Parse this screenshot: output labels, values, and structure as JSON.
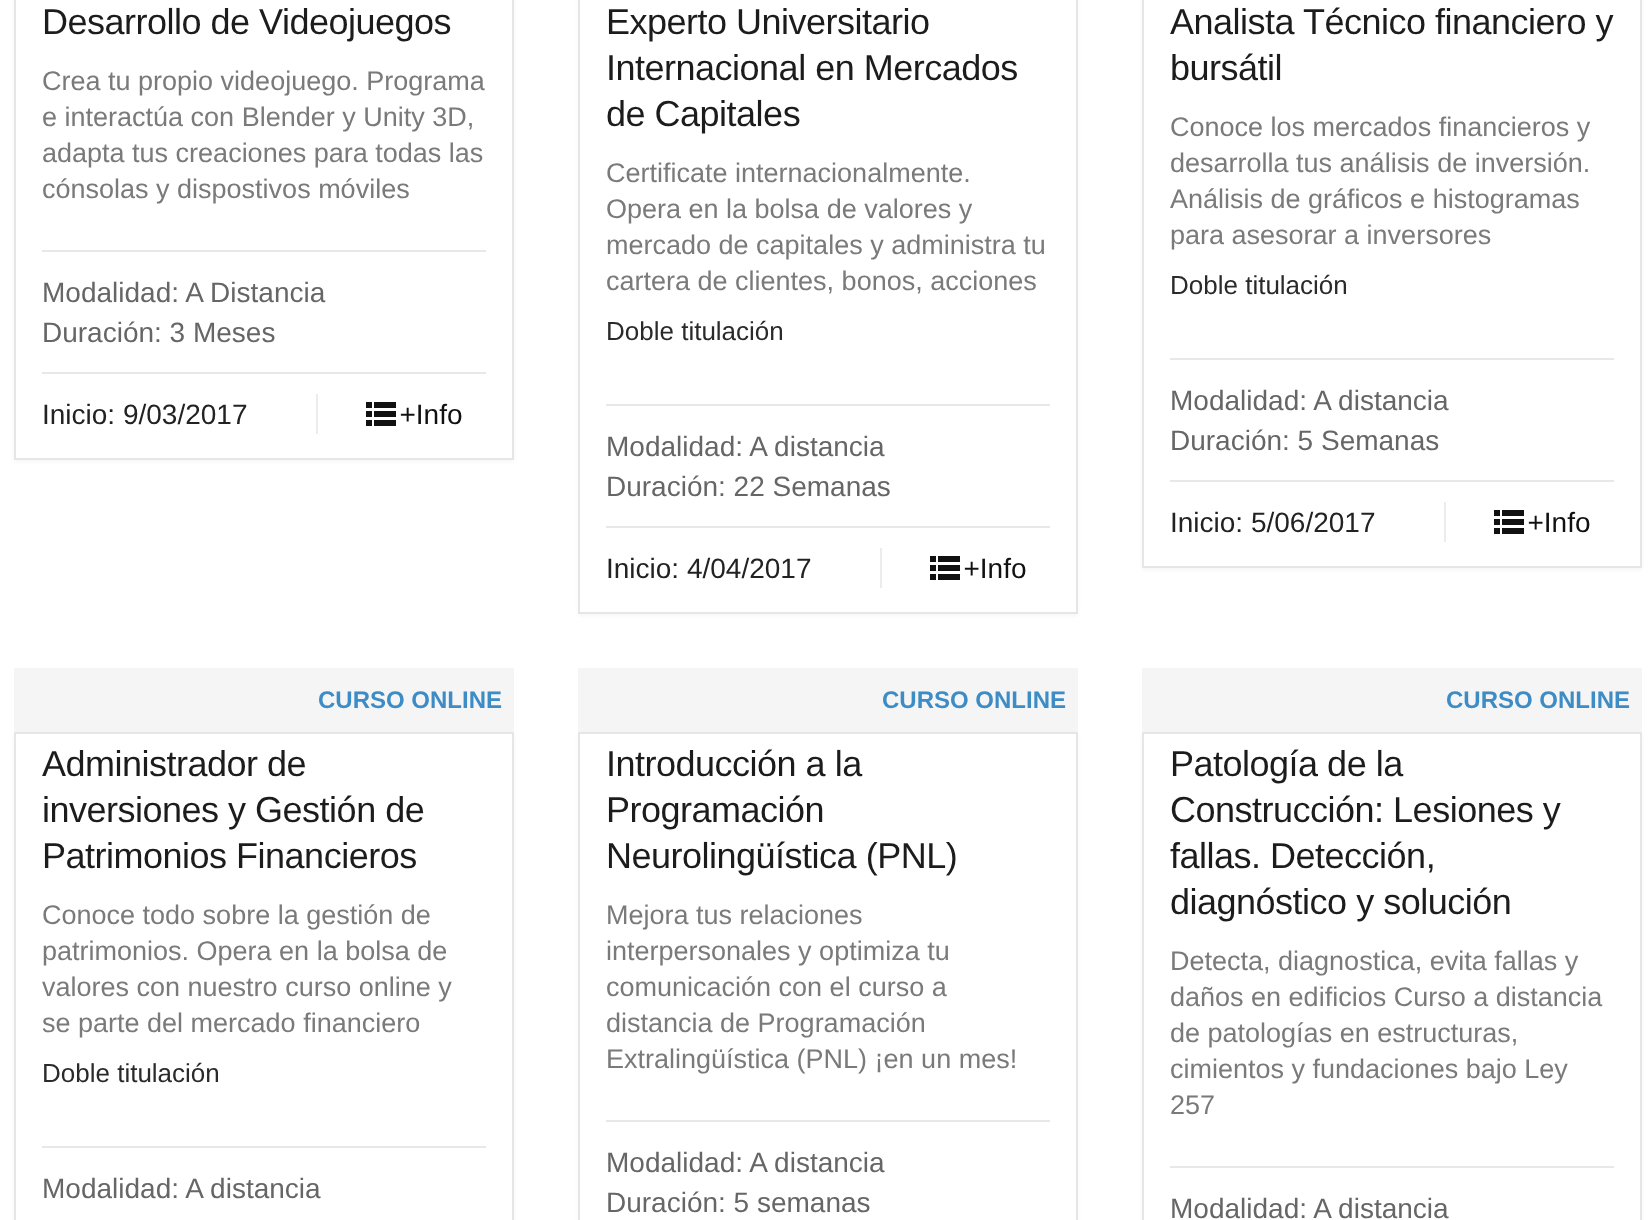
{
  "courses": [
    {
      "title": "Desarrollo de Videojuegos",
      "description": "Crea tu propio videojuego. Programa e interactúa con Blender y Unity 3D, adapta tus creaciones para todas las cónsolas y dispostivos móviles",
      "modality": "Modalidad: A Distancia",
      "duration": "Duración: 3 Meses",
      "start": "Inicio: 9/03/2017",
      "info_link": "+Info"
    },
    {
      "title": "Experto Universitario Internacional en Mercados de Capitales",
      "description": "Certificate internacionalmente. Opera en la bolsa de valores y mercado de capitales y administra tu cartera de clientes, bonos, acciones",
      "double_degree": "Doble titulación",
      "modality": "Modalidad: A distancia",
      "duration": "Duración: 22 Semanas",
      "start": "Inicio: 4/04/2017",
      "info_link": "+Info"
    },
    {
      "title": "Analista Técnico financiero y bursátil",
      "description": "Conoce los mercados financieros y desarrolla tus análisis de inversión. Análisis de gráficos e histogramas para asesorar a inversores",
      "double_degree": "Doble titulación",
      "modality": "Modalidad: A distancia",
      "duration": "Duración: 5 Semanas",
      "start": "Inicio: 5/06/2017",
      "info_link": "+Info"
    },
    {
      "badge": "CURSO ONLINE",
      "title": "Administrador de inversiones y Gestión de Patrimonios Financieros",
      "description": "Conoce todo sobre la gestión de patrimonios. Opera en la bolsa de valores con nuestro curso online y se parte del mercado financiero",
      "double_degree": "Doble titulación",
      "modality": "Modalidad: A distancia"
    },
    {
      "badge": "CURSO ONLINE",
      "title": "Introducción a la Programación Neurolingüística (PNL)",
      "description": "Mejora tus relaciones interpersonales y optimiza tu comunicación con el curso a distancia de Programación Extralingüística (PNL) ¡en un mes!",
      "modality": "Modalidad: A distancia",
      "duration": "Duración: 5 semanas"
    },
    {
      "badge": "CURSO ONLINE",
      "title": "Patología de la Construcción: Lesiones y fallas. Detección, diagnóstico y solución",
      "description": "Detecta, diagnostica, evita fallas y daños en edificios Curso a distancia de patologías en estructuras, cimientos y fundaciones bajo Ley 257",
      "modality": "Modalidad: A distancia"
    }
  ]
}
